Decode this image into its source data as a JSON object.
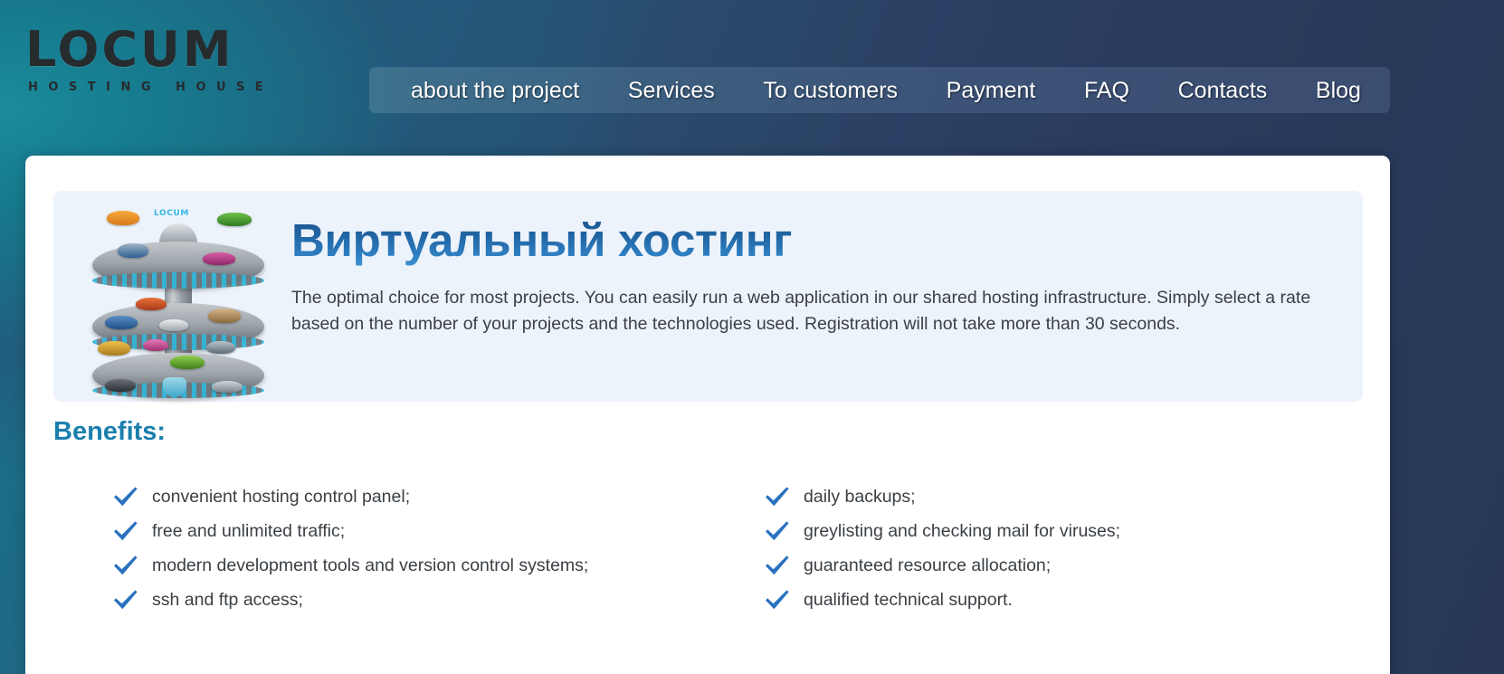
{
  "site": {
    "logo_main": "LOCUM",
    "logo_sub": "HOSTING HOUSE",
    "logo_badge": "LOCUM"
  },
  "nav": {
    "items": [
      {
        "label": "about the project",
        "name": "nav-about-the-project"
      },
      {
        "label": "Services",
        "name": "nav-services"
      },
      {
        "label": "To customers",
        "name": "nav-to-customers"
      },
      {
        "label": "Payment",
        "name": "nav-payment"
      },
      {
        "label": "FAQ",
        "name": "nav-faq"
      },
      {
        "label": "Contacts",
        "name": "nav-contacts"
      },
      {
        "label": "Blog",
        "name": "nav-blog"
      }
    ]
  },
  "hero": {
    "title": "Виртуальный хостинг",
    "description": "The optimal choice for most projects. You can easily run a web application in our shared hosting infrastructure. Simply select a rate based on the number of your projects and the technologies used. Registration will not take more than 30 seconds."
  },
  "benefits": {
    "heading": "Benefits:",
    "left_column": [
      "convenient hosting control panel;",
      "free and unlimited traffic;",
      "modern development tools and version control systems;",
      "ssh and ftp access;"
    ],
    "right_column": [
      "daily backups;",
      "greylisting and checking mail for viruses;",
      "guaranteed resource allocation;",
      "qualified technical support."
    ]
  },
  "colors": {
    "background_teal": "#17798e",
    "background_navy": "#283757",
    "panel_white": "#ffffff",
    "hero_card": "#edf3fb",
    "heading_blue": "#1a7fad",
    "title_blue": "#2166a5",
    "check_blue": "#2a72c0",
    "body_text": "#3b4045",
    "nav_text": "#ffffff",
    "logo_text": "#262b2e"
  }
}
